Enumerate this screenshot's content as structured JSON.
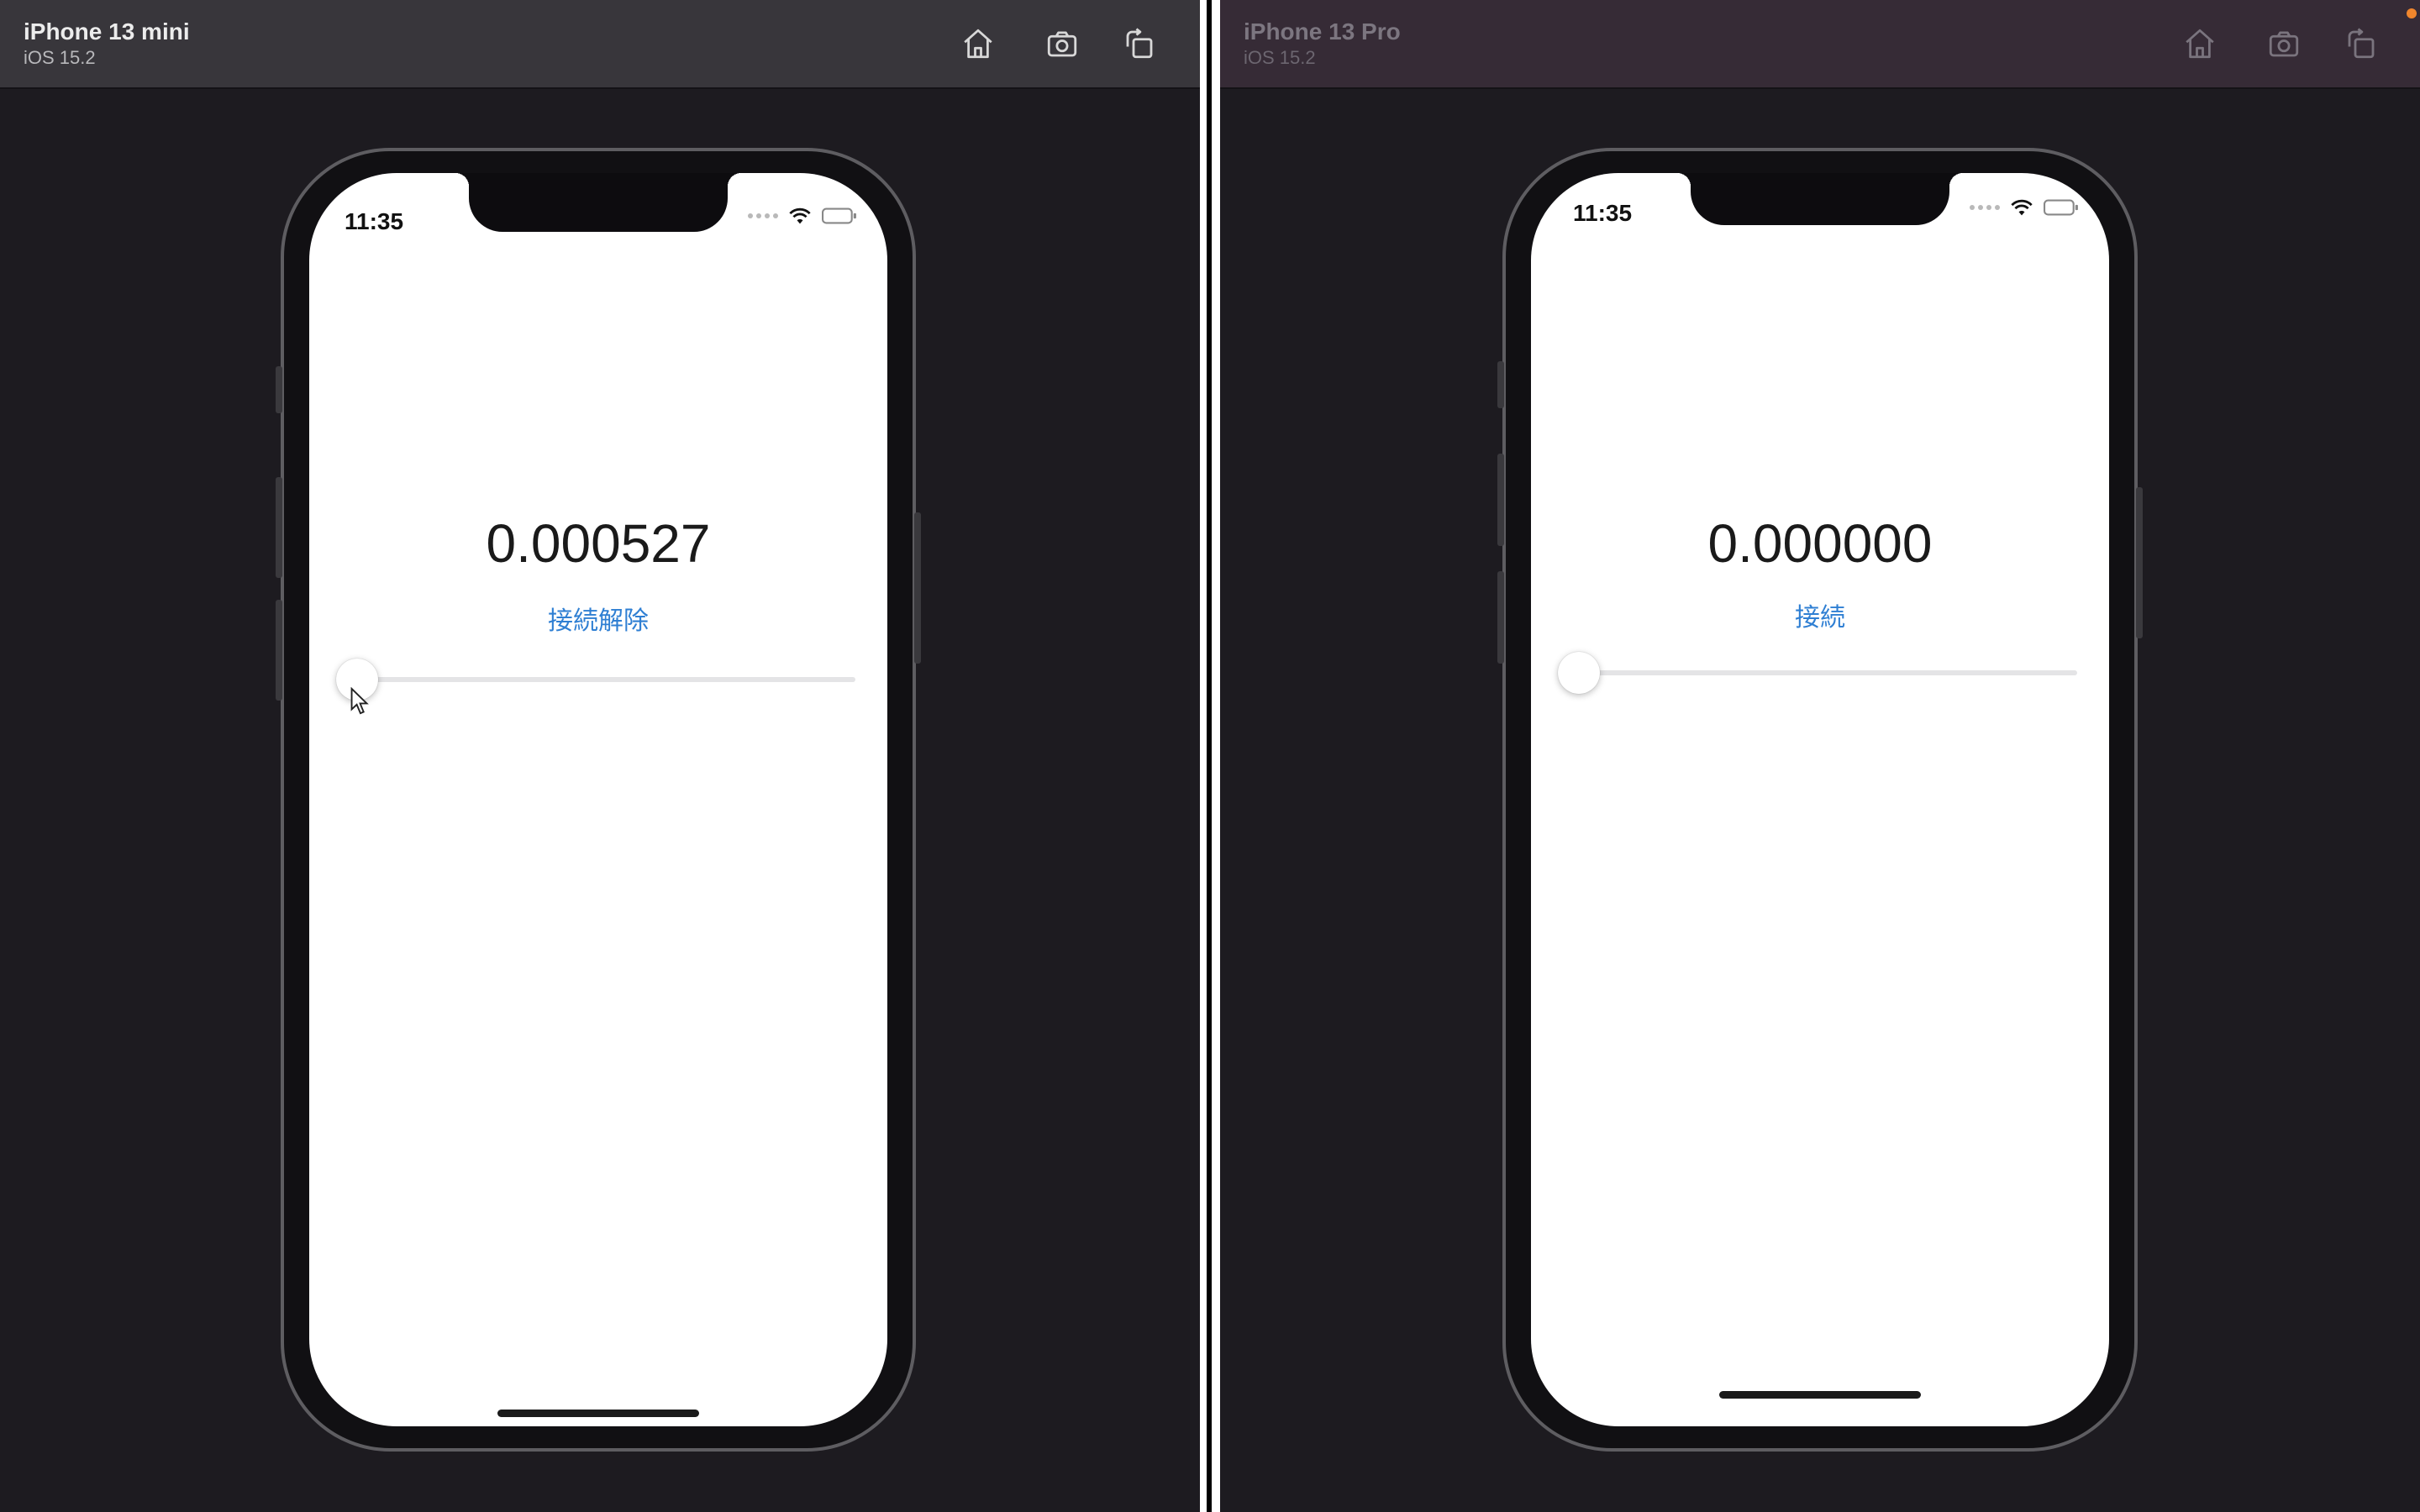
{
  "simulators": [
    {
      "device_name": "iPhone 13 mini",
      "os_version": "iOS 15.2",
      "status_time": "11:35",
      "value": "0.000527",
      "action_label": "接続解除",
      "slider_value": 0.0
    },
    {
      "device_name": "iPhone 13 Pro",
      "os_version": "iOS 15.2",
      "status_time": "11:35",
      "value": "0.000000",
      "action_label": "接続",
      "slider_value": 0.0
    }
  ],
  "toolbar_icons": [
    "home-icon",
    "screenshot-icon",
    "rotate-icon"
  ],
  "colors": {
    "accent": "#2f7fd3",
    "window_background": "#1d1b20",
    "titlebar_active": "#38363b",
    "titlebar_inactive": "#362b36",
    "notification_dot": "#f0862d"
  }
}
